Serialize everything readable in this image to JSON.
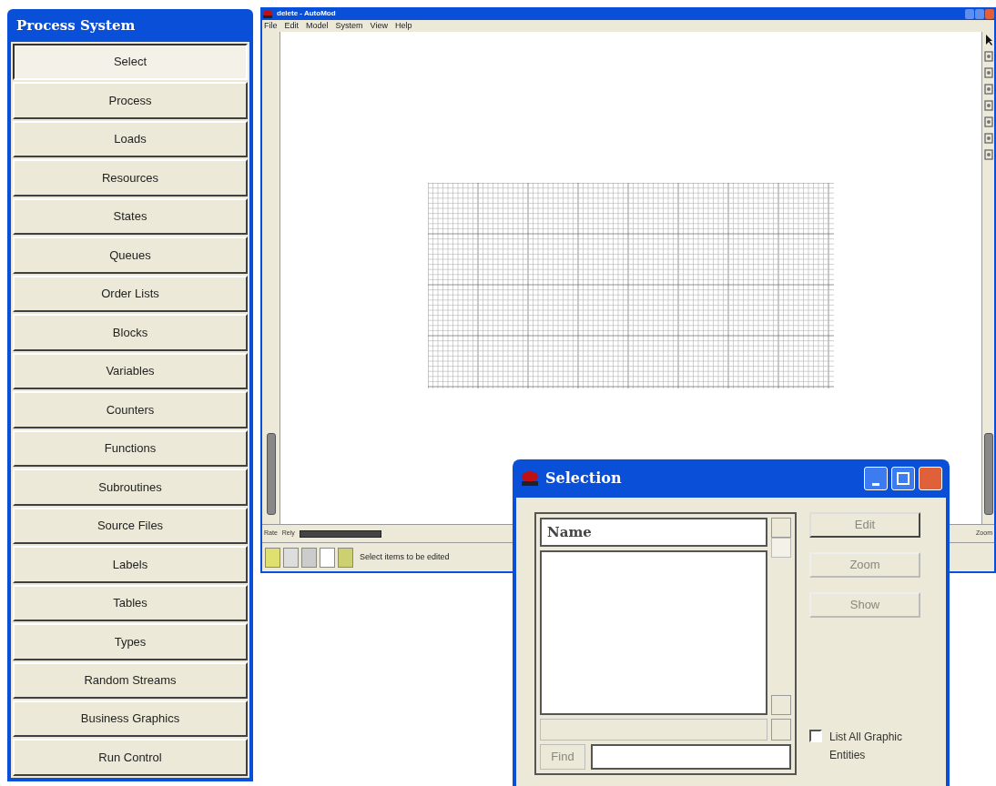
{
  "panel": {
    "title": "Process System",
    "buttons": [
      {
        "label": "Select",
        "selected": true
      },
      {
        "label": "Process",
        "selected": false
      },
      {
        "label": "Loads",
        "selected": false
      },
      {
        "label": "Resources",
        "selected": false
      },
      {
        "label": "States",
        "selected": false
      },
      {
        "label": "Queues",
        "selected": false
      },
      {
        "label": "Order Lists",
        "selected": false
      },
      {
        "label": "Blocks",
        "selected": false
      },
      {
        "label": "Variables",
        "selected": false
      },
      {
        "label": "Counters",
        "selected": false
      },
      {
        "label": "Functions",
        "selected": false
      },
      {
        "label": "Subroutines",
        "selected": false
      },
      {
        "label": "Source Files",
        "selected": false
      },
      {
        "label": "Labels",
        "selected": false
      },
      {
        "label": "Tables",
        "selected": false
      },
      {
        "label": "Types",
        "selected": false
      },
      {
        "label": "Random Streams",
        "selected": false
      },
      {
        "label": "Business Graphics",
        "selected": false
      },
      {
        "label": "Run Control",
        "selected": false
      }
    ]
  },
  "window": {
    "title": "delete - AutoMod",
    "menu": [
      "File",
      "Edit",
      "Model",
      "System",
      "View",
      "Help"
    ],
    "status": {
      "rate_label": "Rate",
      "rely_label": "Rely",
      "message": "Select items to be edited",
      "zoom_label": "Zoom"
    }
  },
  "dialog": {
    "title": "Selection",
    "column_header": "Name",
    "buttons": [
      {
        "label": "Edit",
        "disabled": true
      },
      {
        "label": "Zoom",
        "disabled": true
      },
      {
        "label": "Show",
        "disabled": true
      }
    ],
    "find": {
      "label": "Find",
      "disabled": true
    },
    "checkbox": {
      "label": "List All Graphic Entities",
      "checked": false
    }
  }
}
